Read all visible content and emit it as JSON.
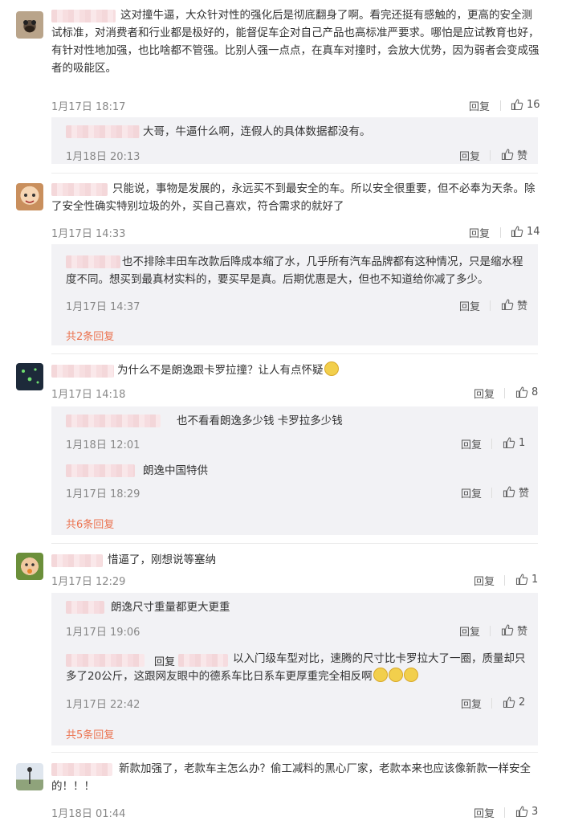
{
  "comments": [
    {
      "text": "这对撞牛逼，大众针对性的强化后是彻底翻身了啊。看完还挺有感触的，更高的安全测试标准，对消费者和行业都是极好的，能督促车企对自己产品也高标准严要求。哪怕是应试教育也好，有针对性地加强，也比啥都不管强。比别人强一点点，在真车对撞时，会放大优势，因为弱者会变成强者的吸能区。",
      "time": "1月17日 18:17",
      "reply": "回复",
      "likes": "16",
      "replies": [
        {
          "text": "大哥，牛逼什么啊，连假人的具体数据都没有。",
          "time": "1月18日 20:13",
          "reply": "回复",
          "likes": "赞"
        }
      ]
    },
    {
      "text": "只能说，事物是发展的，永远买不到最安全的车。所以安全很重要，但不必奉为天条。除了安全性确实特别垃圾的外，买自己喜欢，符合需求的就好了",
      "time": "1月17日 14:33",
      "reply": "回复",
      "likes": "14",
      "replies": [
        {
          "text": "也不排除丰田车改款后降成本缩了水，几乎所有汽车品牌都有这种情况，只是缩水程度不同。想买到最真材实料的，要买早是真。后期优惠是大，但也不知道给你减了多少。",
          "time": "1月17日 14:37",
          "reply": "回复",
          "likes": "赞"
        }
      ],
      "more": "共2条回复"
    },
    {
      "text": "为什么不是朗逸跟卡罗拉撞？让人有点怀疑",
      "time": "1月17日 14:18",
      "reply": "回复",
      "likes": "8",
      "replies": [
        {
          "text": "也不看看朗逸多少钱 卡罗拉多少钱",
          "time": "1月18日 12:01",
          "reply": "回复",
          "likes": "1"
        },
        {
          "text": "朗逸中国特供",
          "time": "1月17日 18:29",
          "reply": "回复",
          "likes": "赞"
        }
      ],
      "more": "共6条回复"
    },
    {
      "text": "惜逼了，刚想说等塞纳",
      "time": "1月17日 12:29",
      "reply": "回复",
      "likes": "1",
      "replies": [
        {
          "text": "朗逸尺寸重量都更大更重",
          "time": "1月17日 19:06",
          "reply": "回复",
          "likes": "赞"
        },
        {
          "reply_prefix": "回复",
          "text": "以入门级车型对比，速腾的尺寸比卡罗拉大了一圈，质量却只多了20公斤，这跟网友眼中的德系车比日系车更厚重完全相反啊",
          "time": "1月17日 22:42",
          "reply": "回复",
          "likes": "2"
        }
      ],
      "more": "共5条回复"
    },
    {
      "text": "新款加强了，老款车主怎么办？偷工减料的黑心厂家，老款本来也应该像新款一样安全的！！！",
      "time": "1月18日 01:44",
      "reply": "回复",
      "likes": "3"
    }
  ],
  "colors": {
    "more_link": "#eb7350",
    "sub_bg": "#f2f2f5"
  }
}
